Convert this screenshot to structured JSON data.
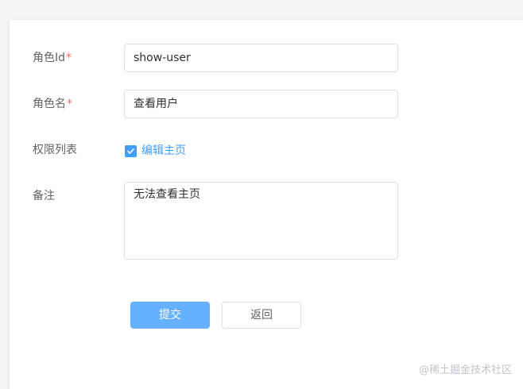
{
  "form": {
    "role_id": {
      "label": "角色Id",
      "required_mark": "*",
      "value": "show-user"
    },
    "role_name": {
      "label": "角色名",
      "required_mark": "*",
      "value": "查看用户"
    },
    "permissions": {
      "label": "权限列表",
      "items": [
        {
          "label": "编辑主页",
          "checked": true
        }
      ]
    },
    "remark": {
      "label": "备注",
      "value": "无法查看主页"
    }
  },
  "actions": {
    "submit_label": "提交",
    "back_label": "返回"
  },
  "watermark": "@稀土掘金技术社区",
  "colors": {
    "primary": "#409eff",
    "primary_light": "#66b1ff",
    "required": "#f56c6c",
    "border": "#dcdfe6"
  }
}
